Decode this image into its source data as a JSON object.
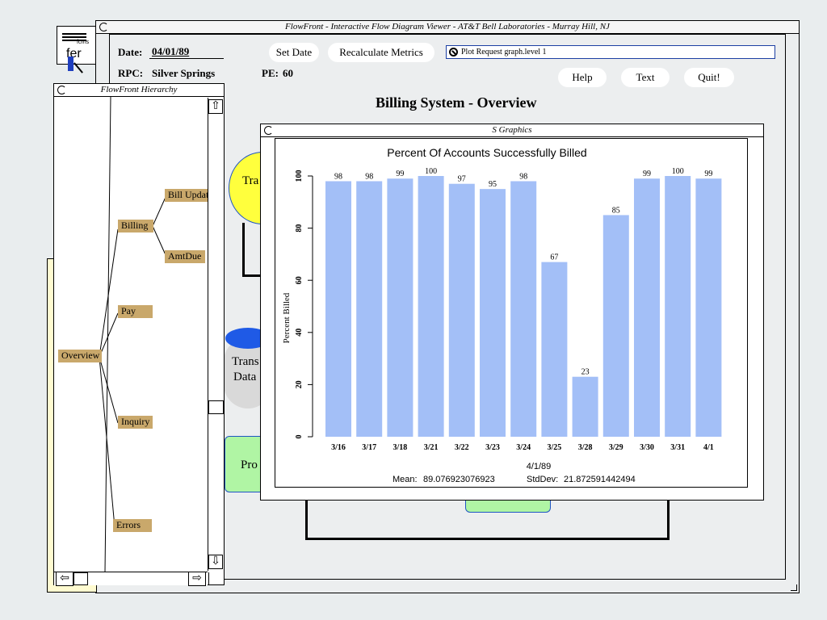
{
  "background": {
    "icon_label": "fcrns",
    "under_text": "fer"
  },
  "main_window": {
    "title": "FlowFront - Interactive Flow Diagram Viewer - AT&T Bell Laboratories - Murray Hill, NJ",
    "date_label": "Date:",
    "date_value": "04/01/89",
    "rpc_label": "RPC:",
    "rpc_value": "Silver Springs",
    "pe_label": "PE:",
    "pe_value": "60",
    "set_date_button": "Set Date",
    "recalc_button": "Recalculate Metrics",
    "plot_request": "Plot Request graph.level 1",
    "help_button": "Help",
    "text_button": "Text",
    "quit_button": "Quit!",
    "heading": "Billing System - Overview",
    "diagram": {
      "yellow_node": "Tra",
      "trans_db_line1": "Trans",
      "trans_db_line2": "Data",
      "green_node": "Pro"
    }
  },
  "hierarchy": {
    "title": "FlowFront Hierarchy",
    "nodes": {
      "overview": "Overview",
      "billing": "Billing",
      "bill_update": "Bill Update",
      "amtdue": "AmtDue",
      "pay": "Pay",
      "inquiry": "Inquiry",
      "errors": "Errors"
    }
  },
  "s_graphics": {
    "title": "S Graphics",
    "mean_label": "Mean:",
    "mean_value": "89.076923076923",
    "stddev_label": "StdDev:",
    "stddev_value": "21.872591442494"
  },
  "colors": {
    "bar": "#a3bff7",
    "tree_node": "#c9a86b",
    "yellow_node": "#ffff3d",
    "green_node": "#b0f5a4",
    "db_top": "#1f5ae6",
    "plot_request_border": "#1c3fa3"
  },
  "chart_data": {
    "type": "bar",
    "title": "Percent Of Accounts Successfully Billed",
    "xlabel": "4/1/89",
    "ylabel": "Percent Billed",
    "categories": [
      "3/16",
      "3/17",
      "3/18",
      "3/21",
      "3/22",
      "3/23",
      "3/24",
      "3/25",
      "3/28",
      "3/29",
      "3/30",
      "3/31",
      "4/1"
    ],
    "values": [
      98,
      98,
      99,
      100,
      97,
      95,
      98,
      67,
      23,
      85,
      99,
      100,
      99
    ],
    "ylim": [
      0,
      100
    ],
    "yticks": [
      0,
      20,
      40,
      60,
      80,
      100
    ],
    "grid": false
  }
}
